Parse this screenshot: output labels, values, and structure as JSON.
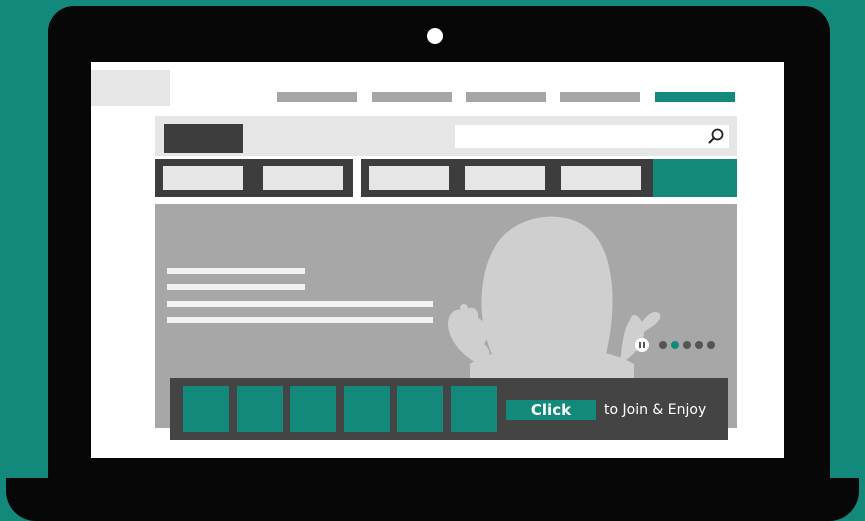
{
  "colors": {
    "background": "#12897a",
    "accent": "#12897a",
    "laptop": "#070707",
    "dark_block": "#3d3d3d",
    "light_block": "#e6e6e6",
    "hero": "#a7a7a7"
  },
  "search": {
    "icon": "search-icon"
  },
  "hero": {
    "carousel": {
      "dot_count": 5,
      "active_dot_index": 1,
      "pause_icon": "pause-icon"
    }
  },
  "cta": {
    "button_label": "Click",
    "text": "to Join & Enjoy"
  }
}
